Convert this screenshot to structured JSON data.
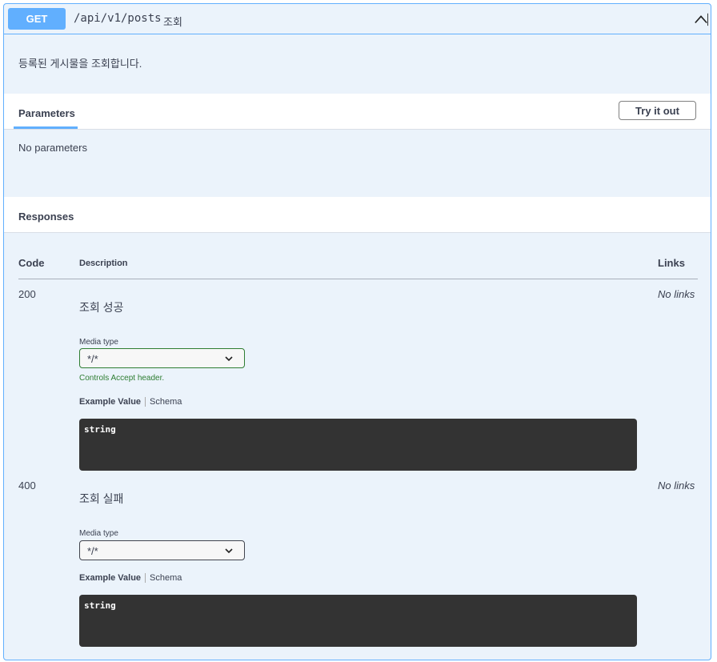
{
  "operation": {
    "method": "GET",
    "path": "/api/v1/posts",
    "summary": "조회",
    "description": "등록된 게시물을 조회합니다."
  },
  "parameters": {
    "tab_label": "Parameters",
    "try_button": "Try it out",
    "empty_text": "No parameters"
  },
  "responses": {
    "title": "Responses",
    "columns": {
      "code": "Code",
      "description": "Description",
      "links": "Links"
    },
    "items": [
      {
        "code": "200",
        "description": "조회 성공",
        "media_type_label": "Media type",
        "media_type_value": "*/*",
        "controls_hint": "Controls Accept header.",
        "example_tab": "Example Value",
        "schema_tab": "Schema",
        "example_body": "string",
        "links": "No links"
      },
      {
        "code": "400",
        "description": "조회 실패",
        "media_type_label": "Media type",
        "media_type_value": "*/*",
        "example_tab": "Example Value",
        "schema_tab": "Schema",
        "example_body": "string",
        "links": "No links"
      }
    ]
  },
  "colors": {
    "get_accent": "#61affe",
    "block_bg": "#ebf3fb",
    "code_bg": "#333333",
    "active_select": "#2e7d32"
  }
}
